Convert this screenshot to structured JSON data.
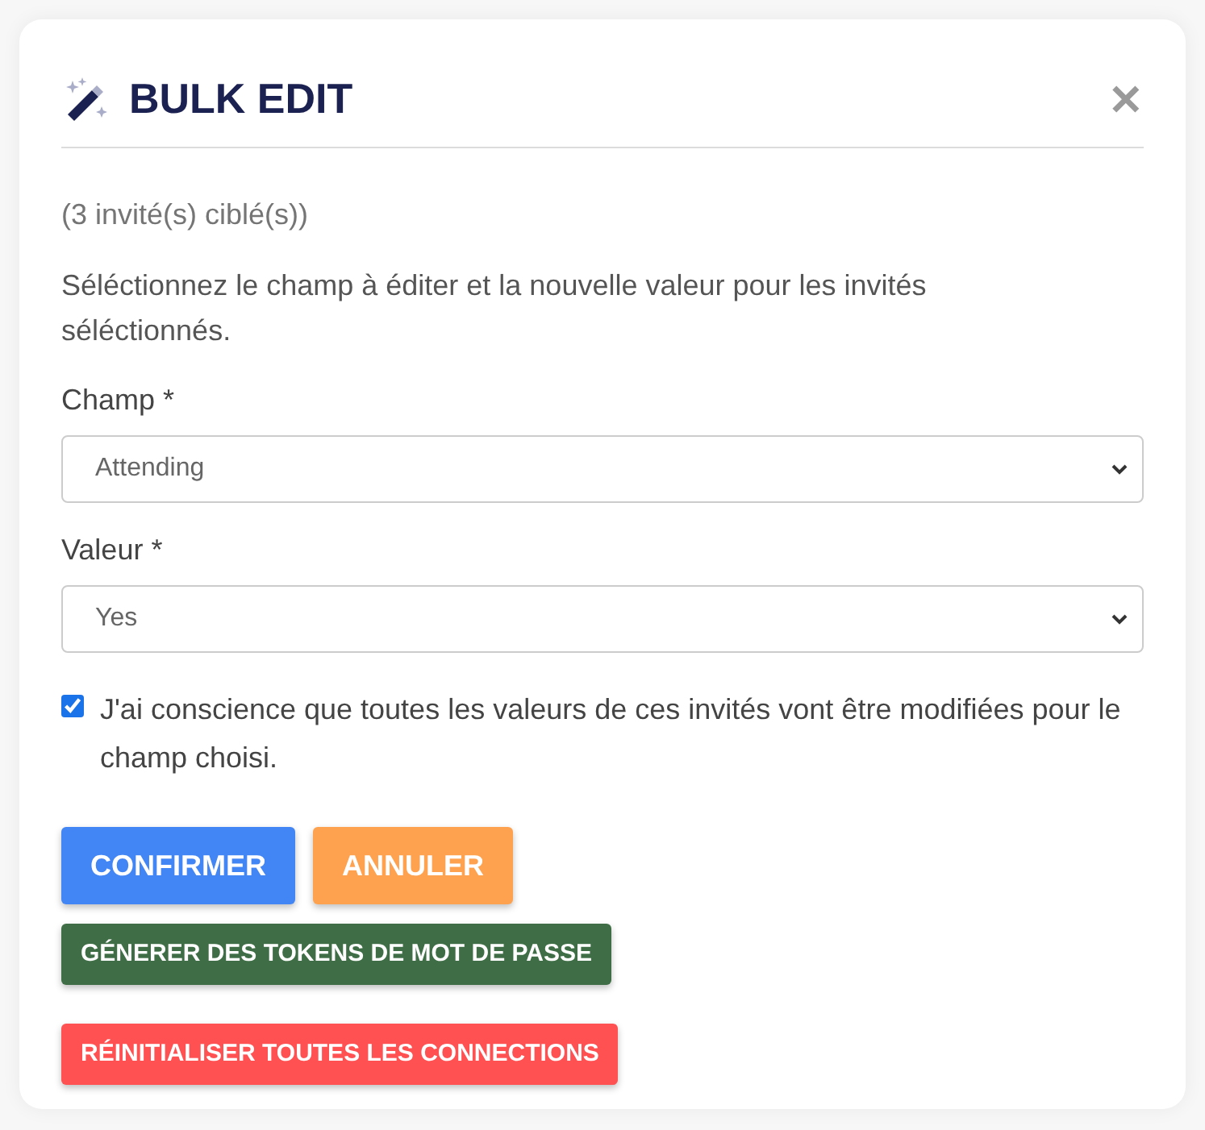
{
  "dialog": {
    "title": "BULK EDIT",
    "close": "✕"
  },
  "target_count": "(3 invité(s) ciblé(s))",
  "description": "Séléctionnez le champ à éditer et la nouvelle valeur pour les invités séléctionnés.",
  "fields": [
    {
      "label": "Champ *",
      "value": "Attending"
    },
    {
      "label": "Valeur *",
      "value": "Yes"
    }
  ],
  "confirmation": {
    "label": "J'ai conscience que toutes les valeurs de ces invités vont être modifiées pour le champ choisi.",
    "checked": true
  },
  "buttons": [
    {
      "label": "CONFIRMER",
      "kind": "primary"
    },
    {
      "label": "ANNULER",
      "kind": "warning"
    },
    {
      "label": "GÉNERER DES TOKENS DE MOT DE PASSE",
      "kind": "success"
    },
    {
      "label": "RÉINITIALISER TOUTES LES CONNECTIONS",
      "kind": "danger"
    }
  ]
}
